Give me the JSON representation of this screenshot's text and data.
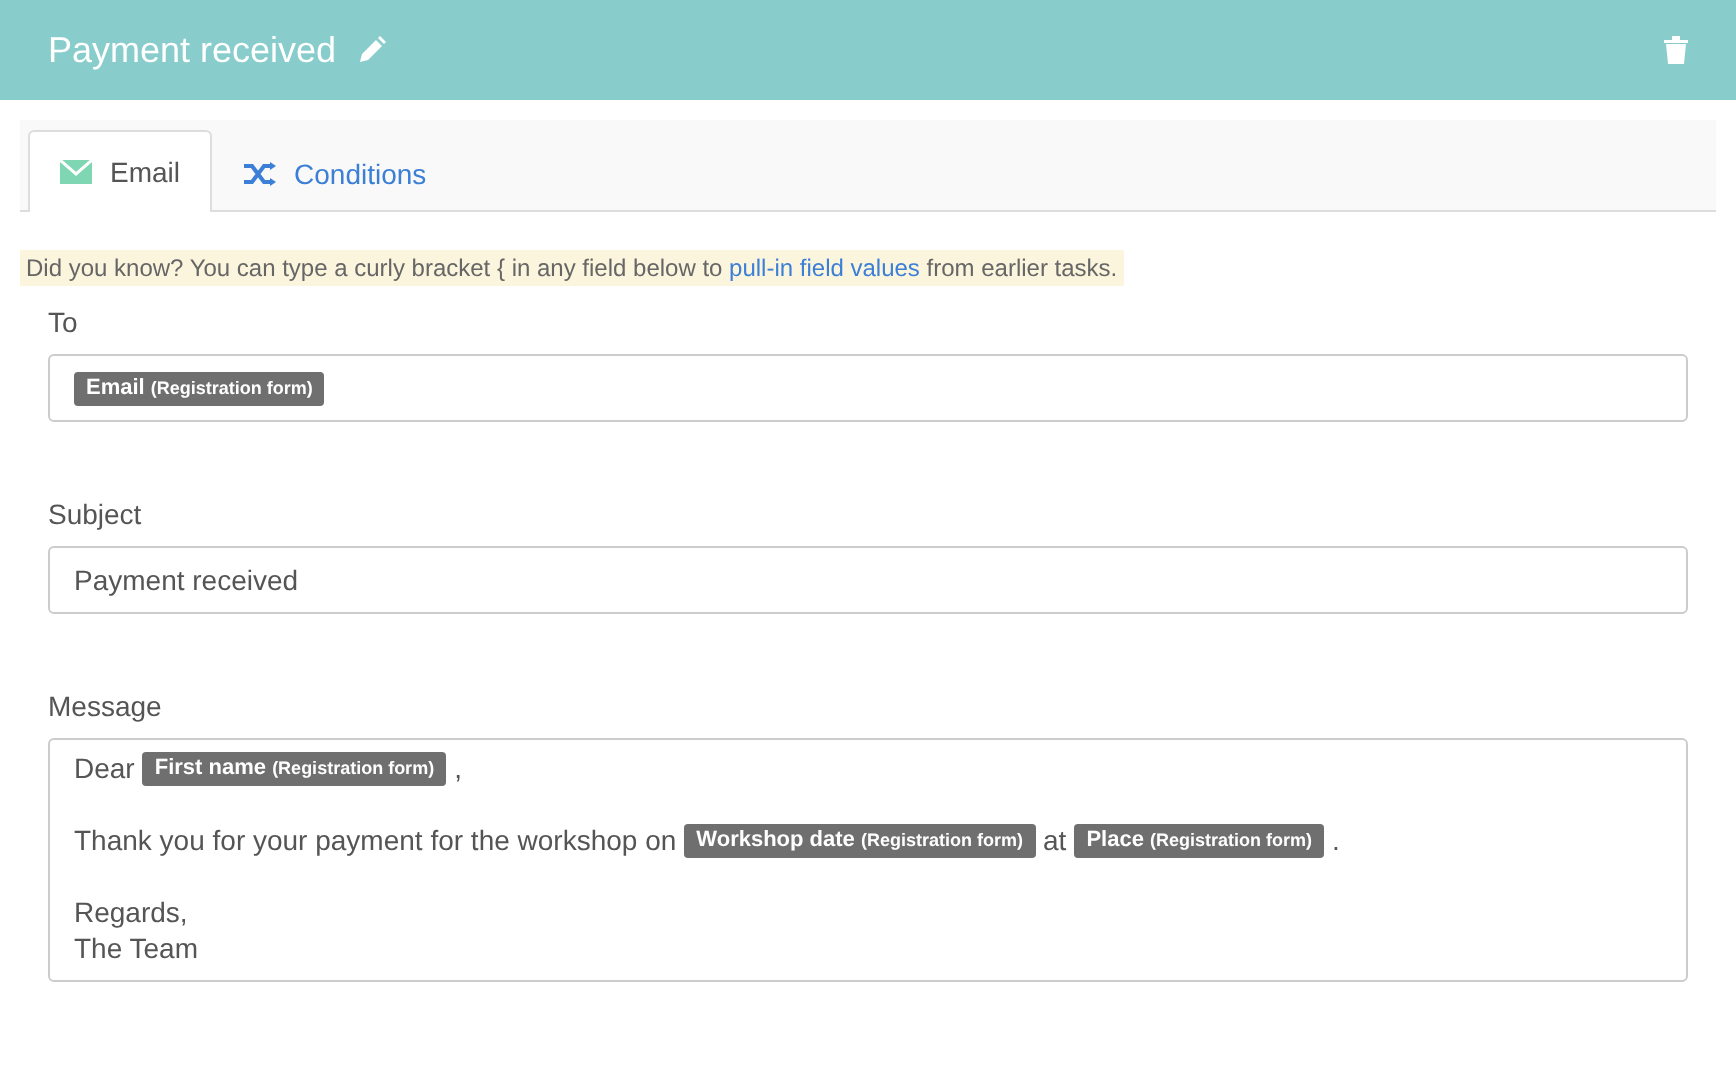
{
  "header": {
    "title": "Payment received"
  },
  "tabs": [
    {
      "label": "Email",
      "kind": "email",
      "selected": true
    },
    {
      "label": "Conditions",
      "kind": "conditions",
      "selected": false
    }
  ],
  "hint": {
    "before": "Did you know? You can type a curly bracket { in any field below to",
    "link": "pull-in field values",
    "after": "from earlier tasks."
  },
  "to": {
    "label": "To",
    "tags": [
      {
        "field": "Email",
        "source": "(Registration form)"
      }
    ]
  },
  "subject": {
    "label": "Subject",
    "value": "Payment received"
  },
  "message": {
    "label": "Message",
    "paragraphs": [
      [
        [
          {
            "kind": "text",
            "text": "Dear"
          },
          {
            "kind": "tag",
            "field": "First name",
            "source": "(Registration form)"
          },
          {
            "kind": "text",
            "text": ","
          }
        ]
      ],
      [
        [
          {
            "kind": "text",
            "text": "Thank you for your payment for the workshop on"
          },
          {
            "kind": "tag",
            "field": "Workshop date",
            "source": "(Registration form)"
          },
          {
            "kind": "text",
            "text": "at"
          },
          {
            "kind": "tag",
            "field": "Place",
            "source": "(Registration form)"
          },
          {
            "kind": "text",
            "text": "."
          }
        ]
      ],
      [
        [
          {
            "kind": "text",
            "text": "Regards,"
          }
        ],
        [
          {
            "kind": "text",
            "text": "The Team"
          }
        ]
      ]
    ]
  }
}
